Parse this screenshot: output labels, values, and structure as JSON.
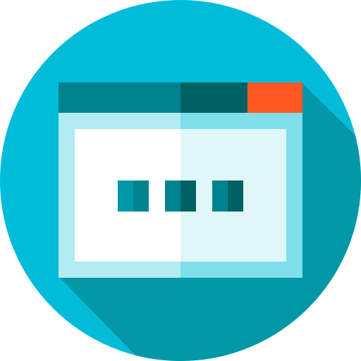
{
  "icon": {
    "name": "browser-window-loading-icon",
    "colors": {
      "circle": "#00BCD8",
      "long_shadow": "#0097A7",
      "titlebar_left": "#00838F",
      "titlebar_right": "#006064",
      "close_button": "#FF5722",
      "frame_left": "#B2EBF2",
      "frame_right": "#80DEEA",
      "content_left": "#FFFFFF",
      "content_right": "#E0F7FA",
      "dot_dark": "#006064",
      "dot_mid": "#00838F",
      "dot_light": "#0097A7"
    },
    "loading_dots_count": 3
  }
}
